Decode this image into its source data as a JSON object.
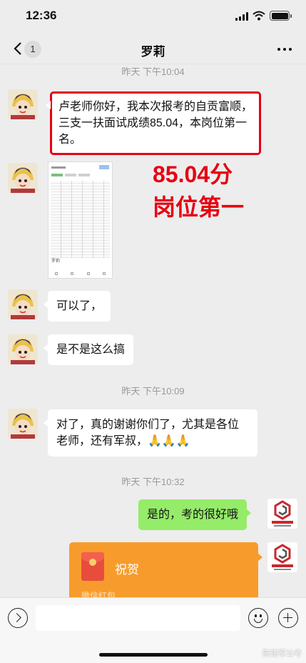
{
  "status_bar": {
    "time": "12:36"
  },
  "nav": {
    "back_count": "1",
    "title": "罗莉"
  },
  "timestamps": {
    "t1": "昨天 下午10:04",
    "t2": "昨天 下午10:09",
    "t3": "昨天 下午10:32"
  },
  "messages": {
    "m1": "卢老师你好，我本次报考的自贡富顺，三支一扶面试成绩85.04，本岗位第一名。",
    "m3": "可以了，",
    "m4": "是不是这么搞",
    "m5": "对了，真的谢谢你们了，尤其是各位老师，还有军叔，🙏🙏🙏",
    "m6": "是的，考的很好哦"
  },
  "annotation": {
    "line1": "85.04分",
    "line2": "岗位第一"
  },
  "thumbnail": {
    "footer": "罗莉"
  },
  "red_packet": {
    "title": "祝贺",
    "subtitle": "微信红包"
  },
  "watermark": "陈建军公考",
  "colors": {
    "accent_red": "#e60012",
    "bubble_green": "#95ec69",
    "red_packet": "#f79c2c"
  }
}
